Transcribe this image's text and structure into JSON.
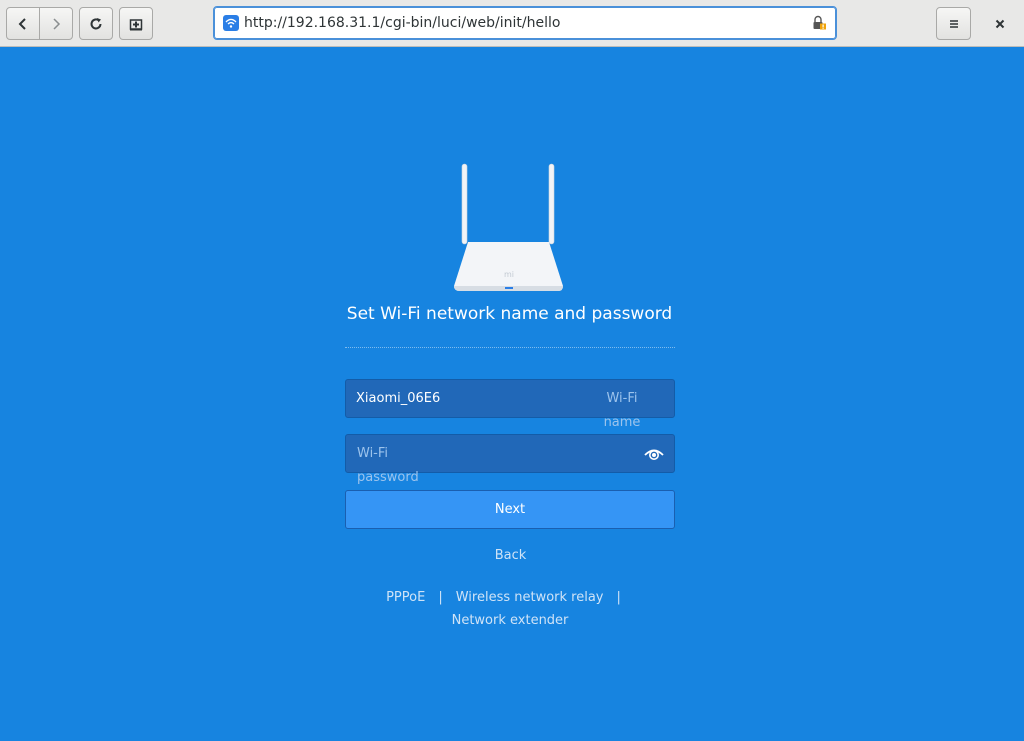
{
  "browser": {
    "url": "http://192.168.31.1/cgi-bin/luci/web/init/hello"
  },
  "page": {
    "title": "Set Wi-Fi network name and password",
    "router_logo": "mi",
    "wifi_name": {
      "value": "Xiaomi_06E6",
      "placeholder": "Wi-Fi name"
    },
    "wifi_password": {
      "value": "",
      "placeholder": "Wi-Fi password"
    },
    "next_label": "Next",
    "back_label": "Back",
    "links": {
      "pppoe": "PPPoE",
      "separator": "|",
      "relay": "Wireless network relay",
      "extender": "Network extender"
    }
  },
  "icons": {
    "back": "chevron-left-icon",
    "forward": "chevron-right-icon",
    "reload": "reload-icon",
    "new_tab": "new-tab-icon",
    "menu": "hamburger-icon",
    "close": "close-icon",
    "site": "wifi-icon",
    "security": "insecure-lock-icon",
    "show_password": "eye-icon"
  },
  "colors": {
    "page_background": "#1784e0",
    "input_background": "#2168b8",
    "button_background": "#3595f5"
  }
}
